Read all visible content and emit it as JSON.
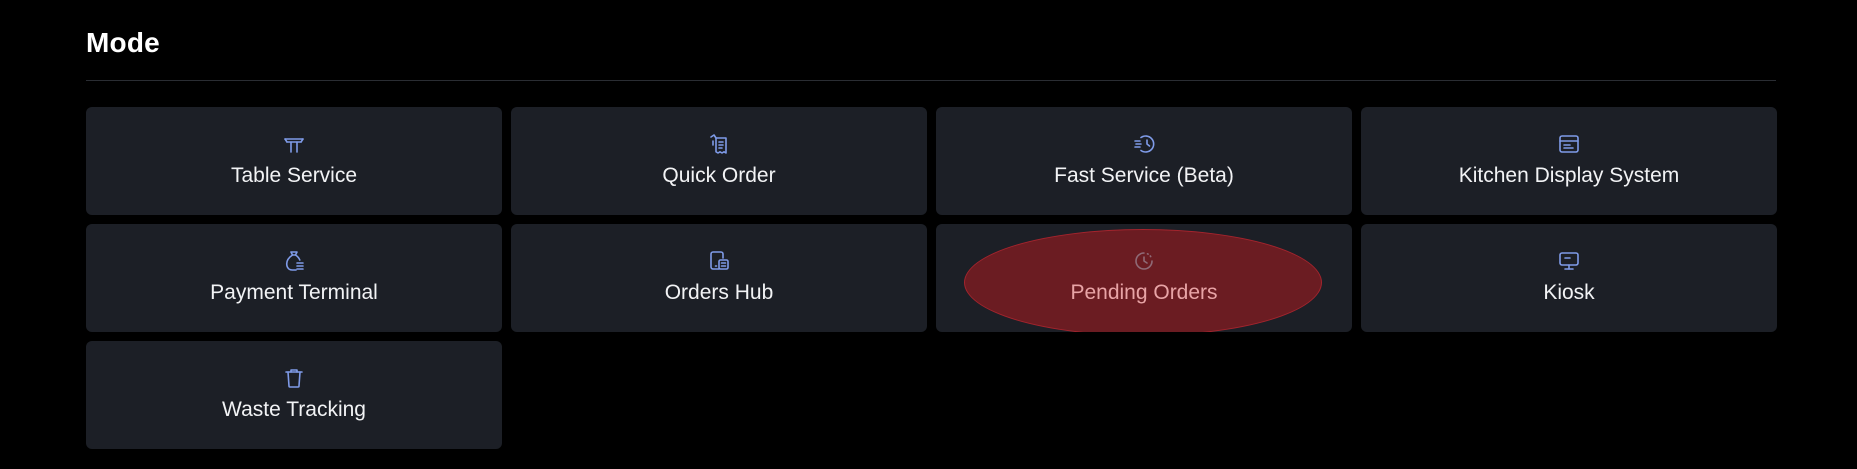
{
  "section": {
    "title": "Mode"
  },
  "modes": [
    {
      "label": "Table Service",
      "icon": "table-icon"
    },
    {
      "label": "Quick Order",
      "icon": "receipt-phone-icon"
    },
    {
      "label": "Fast Service (Beta)",
      "icon": "fast-clock-icon"
    },
    {
      "label": "Kitchen Display System",
      "icon": "display-window-icon"
    },
    {
      "label": "Payment Terminal",
      "icon": "money-bag-icon"
    },
    {
      "label": "Orders Hub",
      "icon": "device-list-icon"
    },
    {
      "label": "Pending Orders",
      "icon": "pending-clock-icon",
      "highlighted": true
    },
    {
      "label": "Kiosk",
      "icon": "monitor-icon"
    },
    {
      "label": "Waste Tracking",
      "icon": "trash-icon"
    }
  ],
  "colors": {
    "background": "#000000",
    "tile": "#1c1f26",
    "icon": "#7f9be8",
    "highlight": "#6b1c22",
    "highlight_text": "#e8a4a6"
  }
}
